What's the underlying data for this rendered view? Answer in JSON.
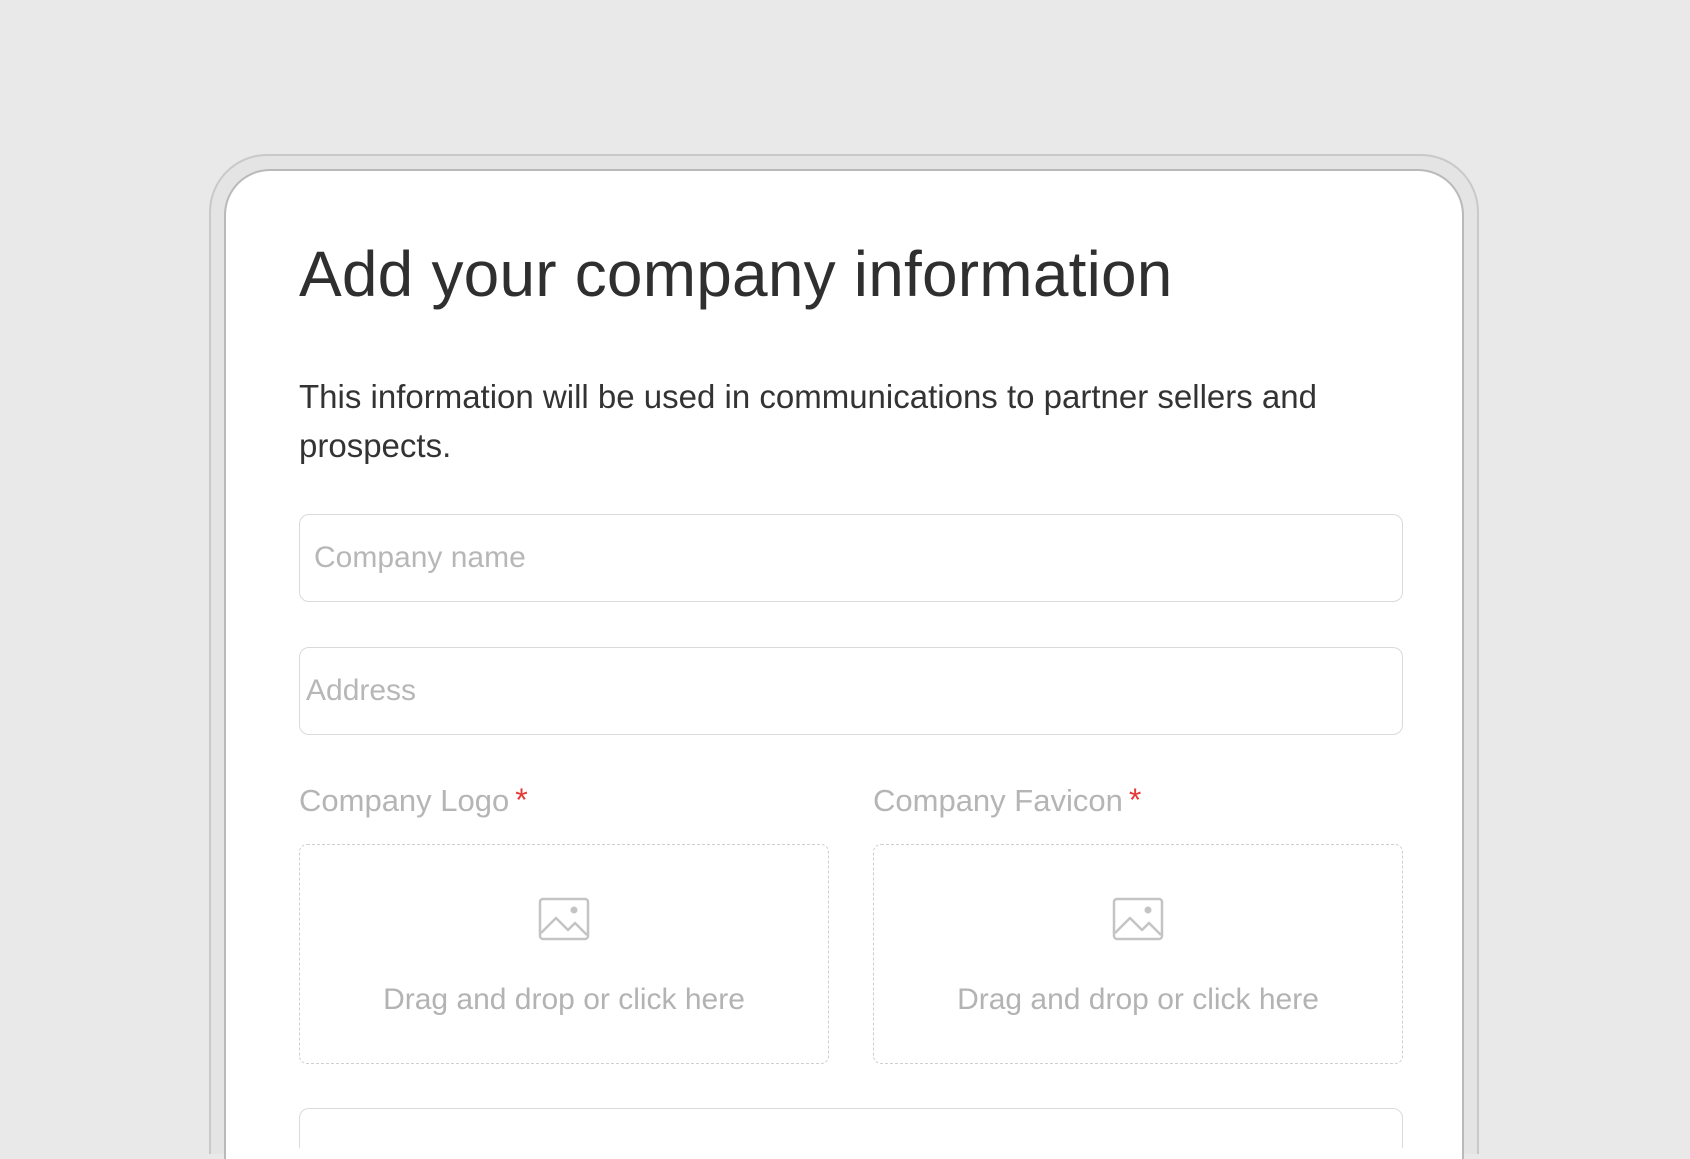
{
  "form": {
    "title": "Add your company information",
    "description": "This information will be used in communications to partner sellers and prospects.",
    "company_name": {
      "value": "",
      "placeholder": "Company name"
    },
    "address": {
      "value": "",
      "placeholder": "Address"
    },
    "uploads": [
      {
        "label": "Company Logo",
        "required_marker": "*",
        "icon": "image-icon",
        "hint": "Drag and drop or click here"
      },
      {
        "label": "Company Favicon",
        "required_marker": "*",
        "icon": "image-icon",
        "hint": "Drag and drop or click here"
      }
    ]
  },
  "colors": {
    "background": "#e9e9e9",
    "card": "#ffffff",
    "required": "#e53935",
    "placeholder": "#b7b7b7"
  }
}
